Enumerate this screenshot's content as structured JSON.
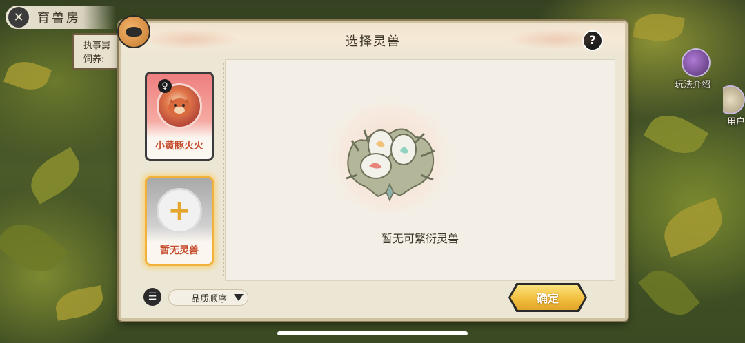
{
  "header": {
    "title": "育兽房",
    "info_line1": "执事舅",
    "info_line2": "饲养:"
  },
  "side_buttons": {
    "guide_label": "玩法介绍",
    "user_label": "用户"
  },
  "panel": {
    "title": "选择灵兽",
    "help_symbol": "?",
    "gender_symbol": "♀",
    "cards": [
      {
        "name": "小黄豚火火",
        "state": "owned"
      },
      {
        "name": "暂无灵兽",
        "symbol": "+",
        "state": "empty-selected"
      }
    ],
    "empty_message": "暂无可繁衍灵兽",
    "sort_label": "品质顺序",
    "confirm_label": "确定"
  },
  "colors": {
    "accent_gold": "#f1bc3a",
    "card_fire": "#ee7f7f",
    "text_dark": "#3d3528"
  }
}
